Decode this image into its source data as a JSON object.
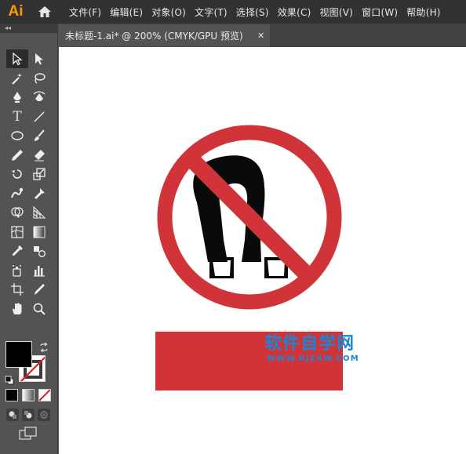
{
  "app": {
    "logo": "Ai"
  },
  "menu": [
    "文件(F)",
    "编辑(E)",
    "对象(O)",
    "文字(T)",
    "选择(S)",
    "效果(C)",
    "视图(V)",
    "窗口(W)",
    "帮助(H)"
  ],
  "toolbar": {
    "collapse_label": "◂◂"
  },
  "tab": {
    "title": "未标题-1.ai* @ 200% (CMYK/GPU 预览)",
    "close": "✕"
  },
  "artwork": {
    "sign_color": "#d13438",
    "magnet_color": "#0a0a0a",
    "band_color": "#d13438"
  },
  "watermark": {
    "title": "软件自学网",
    "url": "WWW.RJZXW.COM",
    "color": "#1b85d6"
  },
  "icons": [
    "selection-tool-icon",
    "direct-selection-tool-icon",
    "magic-wand-icon",
    "lasso-icon",
    "pen-tool-icon",
    "curvature-tool-icon",
    "type-tool-icon",
    "line-tool-icon",
    "ellipse-tool-icon",
    "paintbrush-icon",
    "pencil-icon",
    "eraser-icon",
    "rotate-tool-icon",
    "scale-tool-icon",
    "warp-tool-icon",
    "puppet-warp-icon",
    "shape-builder-icon",
    "perspective-grid-icon",
    "mesh-tool-icon",
    "gradient-tool-icon",
    "eyedropper-icon",
    "blend-tool-icon",
    "symbol-sprayer-icon",
    "graph-tool-icon",
    "artboard-tool-icon",
    "slice-tool-icon",
    "hand-tool-icon",
    "zoom-tool-icon"
  ]
}
